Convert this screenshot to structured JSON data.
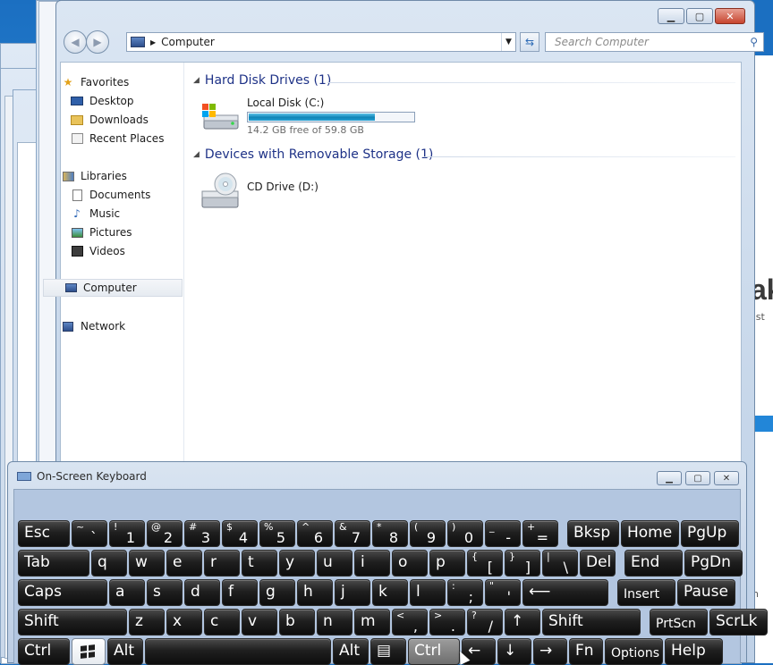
{
  "explorer": {
    "address_location": "Computer",
    "search_placeholder": "Search Computer",
    "groups": [
      {
        "title": "Hard Disk Drives (1)"
      },
      {
        "title": "Devices with Removable Storage (1)"
      }
    ],
    "drives": [
      {
        "name": "Local Disk (C:)",
        "free_text": "14.2 GB free of 59.8 GB",
        "used_fraction": 0.76
      },
      {
        "name": "CD Drive (D:)"
      }
    ],
    "nav": {
      "favorites": "Favorites",
      "desktop": "Desktop",
      "downloads": "Downloads",
      "recent": "Recent Places",
      "libraries": "Libraries",
      "documents": "Documents",
      "music": "Music",
      "pictures": "Pictures",
      "videos": "Videos",
      "computer": "Computer",
      "network": "Network"
    }
  },
  "background_peek": {
    "big_text": "ak",
    "small_text_1": "ast",
    "small_text_2": "in"
  },
  "osk": {
    "title": "On-Screen Keyboard",
    "rows": [
      [
        {
          "main": "Esc"
        },
        {
          "sub": "~",
          "main": "`"
        },
        {
          "sub": "!",
          "main": "1"
        },
        {
          "sub": "@",
          "main": "2"
        },
        {
          "sub": "#",
          "main": "3"
        },
        {
          "sub": "$",
          "main": "4"
        },
        {
          "sub": "%",
          "main": "5"
        },
        {
          "sub": "^",
          "main": "6"
        },
        {
          "sub": "&",
          "main": "7"
        },
        {
          "sub": "*",
          "main": "8"
        },
        {
          "sub": "(",
          "main": "9"
        },
        {
          "sub": ")",
          "main": "0"
        },
        {
          "sub": "_",
          "main": "-"
        },
        {
          "sub": "+",
          "main": "="
        },
        {
          "main": "Bksp"
        },
        {
          "main": "Home"
        },
        {
          "main": "PgUp"
        }
      ],
      [
        {
          "main": "Tab"
        },
        {
          "main": "q"
        },
        {
          "main": "w"
        },
        {
          "main": "e"
        },
        {
          "main": "r"
        },
        {
          "main": "t"
        },
        {
          "main": "y"
        },
        {
          "main": "u"
        },
        {
          "main": "i"
        },
        {
          "main": "o"
        },
        {
          "main": "p"
        },
        {
          "sub": "{",
          "main": "["
        },
        {
          "sub": "}",
          "main": "]"
        },
        {
          "sub": "|",
          "main": "\\"
        },
        {
          "main": "Del"
        },
        {
          "main": "End"
        },
        {
          "main": "PgDn"
        }
      ],
      [
        {
          "main": "Caps"
        },
        {
          "main": "a"
        },
        {
          "main": "s"
        },
        {
          "main": "d"
        },
        {
          "main": "f"
        },
        {
          "main": "g"
        },
        {
          "main": "h"
        },
        {
          "main": "j"
        },
        {
          "main": "k"
        },
        {
          "main": "l"
        },
        {
          "sub": ":",
          "main": ";"
        },
        {
          "sub": "\"",
          "main": "'"
        },
        {
          "main": "⟵"
        },
        {
          "main": "Insert"
        },
        {
          "main": "Pause"
        }
      ],
      [
        {
          "main": "Shift"
        },
        {
          "main": "z"
        },
        {
          "main": "x"
        },
        {
          "main": "c"
        },
        {
          "main": "v"
        },
        {
          "main": "b"
        },
        {
          "main": "n"
        },
        {
          "main": "m"
        },
        {
          "sub": "<",
          "main": ","
        },
        {
          "sub": ">",
          "main": "."
        },
        {
          "sub": "?",
          "main": "/"
        },
        {
          "main": "↑"
        },
        {
          "main": "Shift"
        },
        {
          "main": "PrtScn"
        },
        {
          "main": "ScrLk"
        }
      ],
      [
        {
          "main": "Ctrl"
        },
        {
          "main": ""
        },
        {
          "main": "Alt"
        },
        {
          "main": ""
        },
        {
          "main": "Alt"
        },
        {
          "main": "▤"
        },
        {
          "main": "Ctrl"
        },
        {
          "main": "←"
        },
        {
          "main": "↓"
        },
        {
          "main": "→"
        },
        {
          "main": "Fn"
        },
        {
          "main": "Options"
        },
        {
          "main": "Help"
        }
      ]
    ]
  }
}
